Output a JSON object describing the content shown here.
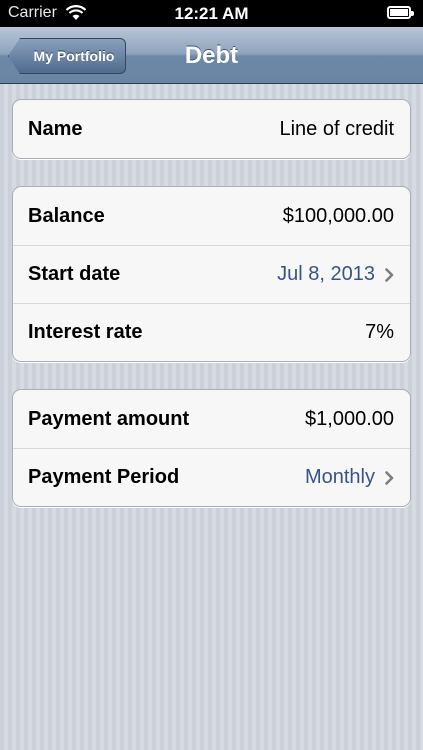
{
  "status_bar": {
    "carrier": "Carrier",
    "time": "12:21 AM"
  },
  "nav": {
    "back_label": "My Portfolio",
    "title": "Debt"
  },
  "groups": [
    {
      "rows": [
        {
          "label": "Name",
          "value": "Line of credit",
          "disclosure": false
        }
      ]
    },
    {
      "rows": [
        {
          "label": "Balance",
          "value": "$100,000.00",
          "disclosure": false
        },
        {
          "label": "Start date",
          "value": "Jul 8, 2013",
          "disclosure": true
        },
        {
          "label": "Interest rate",
          "value": "7%",
          "disclosure": false
        }
      ]
    },
    {
      "rows": [
        {
          "label": "Payment amount",
          "value": "$1,000.00",
          "disclosure": false
        },
        {
          "label": "Payment Period",
          "value": "Monthly",
          "disclosure": true
        }
      ]
    }
  ],
  "colors": {
    "link_value": "#385487",
    "nav_bar": "#6d87a6"
  },
  "icons": {
    "wifi": "wifi-icon",
    "battery": "battery-icon",
    "disclosure": "chevron-right-icon"
  }
}
